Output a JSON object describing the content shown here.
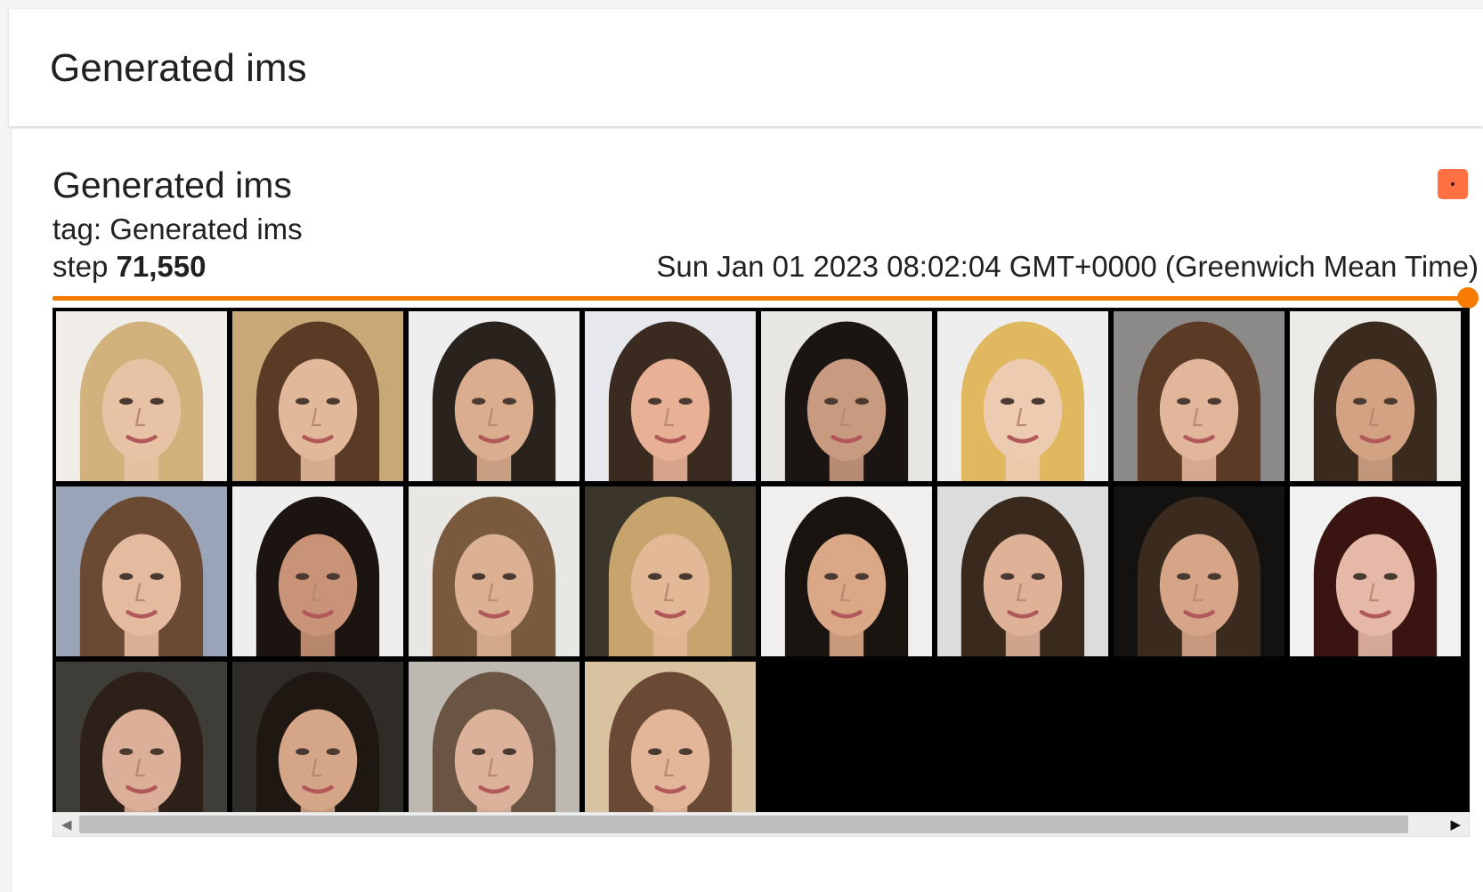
{
  "header": {
    "title": "Generated ims"
  },
  "card": {
    "title": "Generated ims",
    "tag_prefix": "tag:",
    "tag": "Generated ims",
    "step_prefix": "step",
    "step": "71,550",
    "timestamp": "Sun Jan 01 2023 08:02:04 GMT+0000 (Greenwich Mean Time)",
    "slider_position": 1.0
  },
  "colors": {
    "accent": "#f57c00",
    "expand_button": "#ff7043",
    "grid_background": "#000000"
  },
  "images": {
    "columns": 8,
    "rows": 3,
    "count": 20,
    "faces": [
      {
        "bg": "#f0ede8",
        "hair": "#d2b27c",
        "skin": "#e8c2a4"
      },
      {
        "bg": "#c9a878",
        "hair": "#5a3b25",
        "skin": "#e1b99a"
      },
      {
        "bg": "#eeeeee",
        "hair": "#2a221d",
        "skin": "#d9ad8e"
      },
      {
        "bg": "#e6e8ee",
        "hair": "#3a2a20",
        "skin": "#e8b196"
      },
      {
        "bg": "#e8e6e3",
        "hair": "#1a1412",
        "skin": "#c89a7f"
      },
      {
        "bg": "#eeeeee",
        "hair": "#e0b860",
        "skin": "#edcbb0"
      },
      {
        "bg": "#8c8a88",
        "hair": "#5b3a26",
        "skin": "#e2b69a"
      },
      {
        "bg": "#ecebe8",
        "hair": "#3b2b1f",
        "skin": "#d2a283"
      },
      {
        "bg": "#9aa4b8",
        "hair": "#6b4a34",
        "skin": "#e5bba0"
      },
      {
        "bg": "#eeeeee",
        "hair": "#1c1410",
        "skin": "#c99377"
      },
      {
        "bg": "#e9e7e4",
        "hair": "#7a5a3e",
        "skin": "#dcb093"
      },
      {
        "bg": "#3b352a",
        "hair": "#c7a46e",
        "skin": "#e2b896"
      },
      {
        "bg": "#f0efee",
        "hair": "#1a1410",
        "skin": "#dba887"
      },
      {
        "bg": "#dcdcdc",
        "hair": "#3a2a1e",
        "skin": "#dfb298"
      },
      {
        "bg": "#141210",
        "hair": "#3b2a1e",
        "skin": "#d6a487"
      },
      {
        "bg": "#f1f1f1",
        "hair": "#3a1410",
        "skin": "#e6b8a8"
      },
      {
        "bg": "#3f3d38",
        "hair": "#2c2018",
        "skin": "#dcb098"
      },
      {
        "bg": "#2f2c28",
        "hair": "#1f1712",
        "skin": "#d4a586"
      },
      {
        "bg": "#bdb9b0",
        "hair": "#6a5443",
        "skin": "#dcb29a"
      },
      {
        "bg": "#d8c2a0",
        "hair": "#6a4a34",
        "skin": "#e3b69a"
      }
    ]
  },
  "scrollbar": {
    "left_icon": "arrow-left-icon",
    "right_icon": "arrow-right-icon"
  }
}
